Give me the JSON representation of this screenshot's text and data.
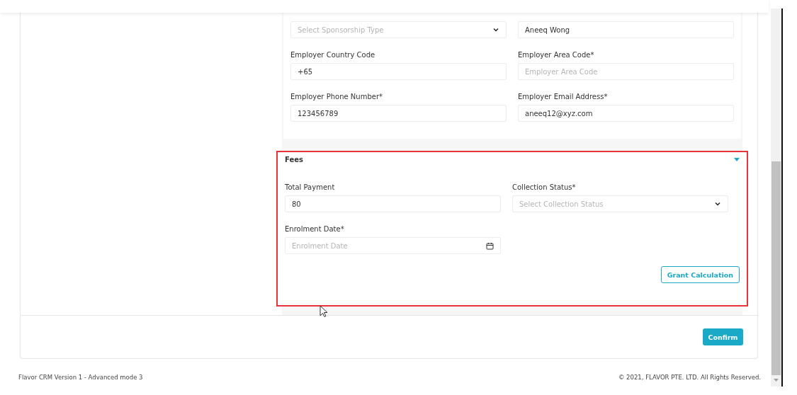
{
  "employer_section": {
    "rows": [
      [
        {
          "kind": "select",
          "placeholder": "Select Sponsorship Type"
        },
        {
          "kind": "text",
          "value": "Aneeq Wong"
        }
      ],
      [
        {
          "label": "Employer Country Code",
          "kind": "text",
          "value": "+65"
        },
        {
          "label": "Employer Area Code*",
          "kind": "text",
          "placeholder": "Employer Area Code"
        }
      ],
      [
        {
          "label": "Employer Phone Number*",
          "kind": "text",
          "value": "123456789"
        },
        {
          "label": "Employer Email Address*",
          "kind": "text",
          "value": "aneeq12@xyz.com"
        }
      ]
    ]
  },
  "fees_section": {
    "title": "Fees",
    "expanded": true,
    "highlighted": true,
    "rows": [
      [
        {
          "label": "Total Payment",
          "kind": "text",
          "value": "80"
        },
        {
          "label": "Collection Status*",
          "kind": "select",
          "placeholder": "Select Collection Status"
        }
      ],
      [
        {
          "label": "Enrolment Date*",
          "kind": "date",
          "placeholder": "Enrolment Date"
        }
      ]
    ],
    "button": "Grant Calculation"
  },
  "confirm_button": "Confirm",
  "footer": {
    "version": "Flavor CRM Version 1 - Advanced mode 3",
    "copyright": "© 2021, FLAVOR PTE. LTD. All Rights Reserved."
  }
}
